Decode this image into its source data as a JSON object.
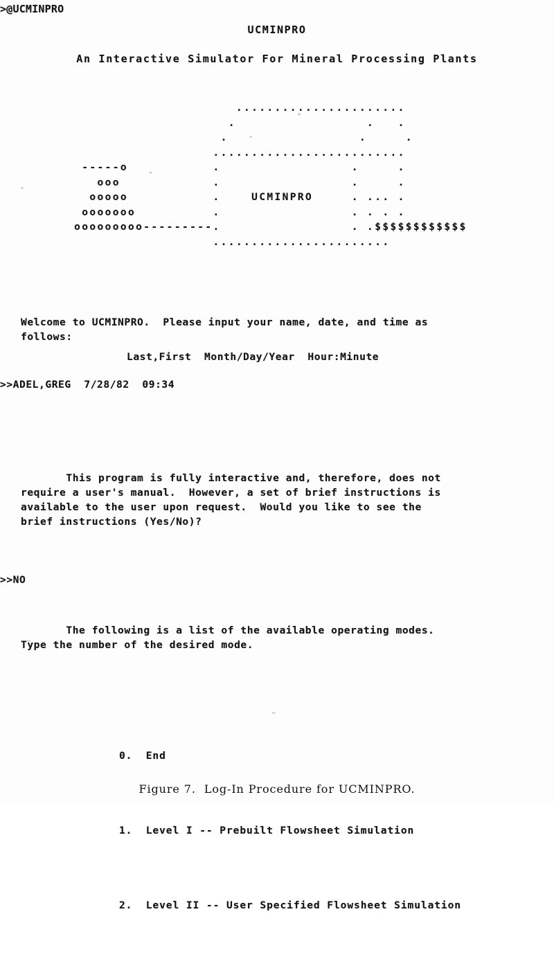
{
  "terminal": {
    "top_prompt": ">@UCMINPRO",
    "title": "UCMINPRO",
    "subtitle": "An Interactive Simulator For Mineral Processing Plants",
    "ascii_art": "                      ......................\n                     .                 .   .\n                    .                 .     .\n                   .........................\n  -----o           .                 .     .\n    ooo            .                 .     .\n   ooooo           .    UCMINPRO     . ... .\n  ooooooo          .                 . . . .\n ooooooooo---------.                 . .$$$$$$$$$$$$\n                   .......................",
    "welcome": "Welcome to UCMINPRO.  Please input your name, date, and time as\nfollows:",
    "input_format": "Last,First  Month/Day/Year  Hour:Minute",
    "login_entry": ">>ADEL,GREG  7/28/82  09:34",
    "instructions": "       This program is fully interactive and, therefore, does not\nrequire a user's manual.  However, a set of brief instructions is\navailable to the user upon request.  Would you like to see the\nbrief instructions (Yes/No)?",
    "instructions_answer": ">>NO",
    "modes_intro": "       The following is a list of the available operating modes.\nType the number of the desired mode.",
    "modes": [
      "0.  End",
      "1.  Level I -- Prebuilt Flowsheet Simulation",
      "2.  Level II -- User Specified Flowsheet Simulation"
    ]
  },
  "figure": {
    "caption": "Figure 7.  Log-In Procedure for UCMINPRO."
  }
}
